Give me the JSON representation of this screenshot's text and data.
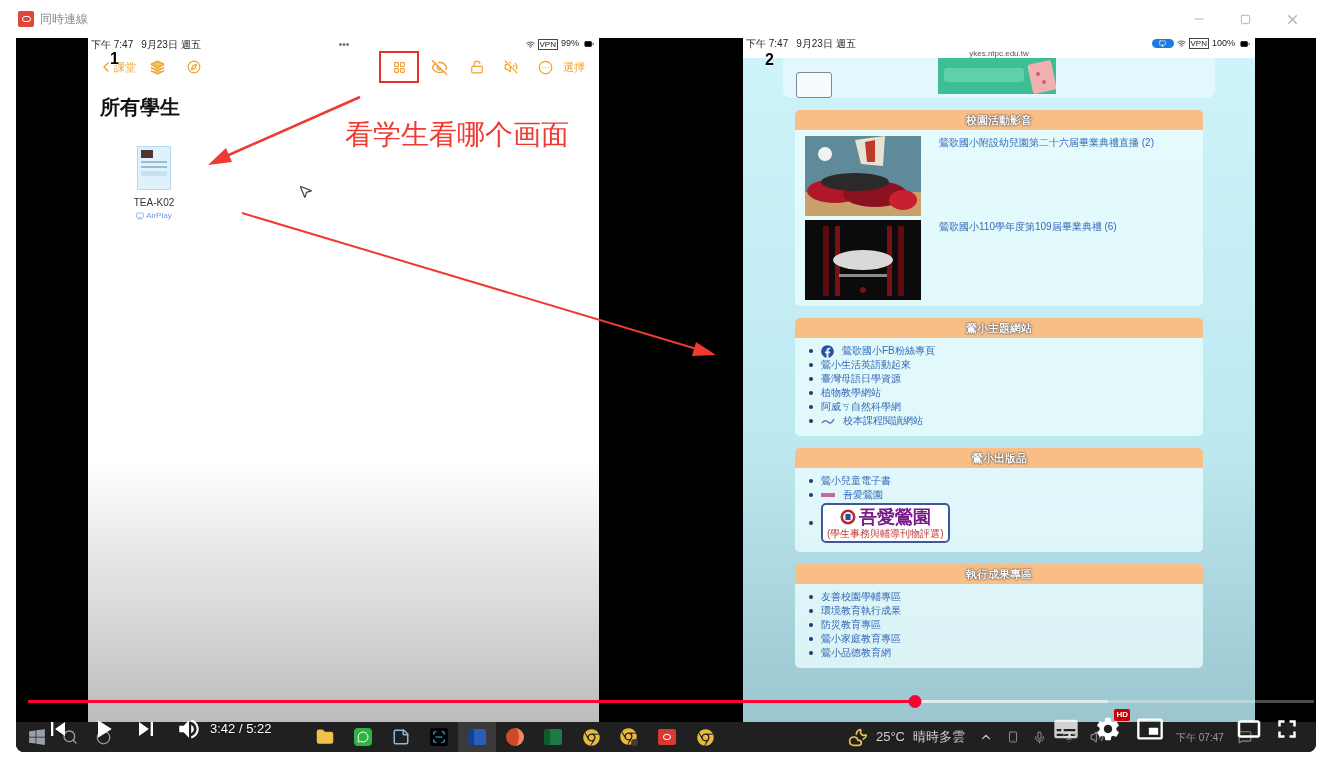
{
  "window": {
    "title": "同時連線"
  },
  "left_screen": {
    "status_bar": {
      "time": "下午 7:47",
      "date": "9月23日 週五",
      "dots": "•••",
      "vpn": "VPN",
      "battery": "99%"
    },
    "toolbar": {
      "back": "課堂",
      "action": "選擇"
    },
    "title": "所有學生",
    "students": [
      {
        "name": "TEA-K02",
        "status": "AirPlay"
      }
    ]
  },
  "right_screen": {
    "status_bar": {
      "time": "下午 7:47",
      "date": "9月23日 週五",
      "vpn": "VPN",
      "battery": "100%"
    },
    "url": "ykes.ntpc.edu.tw",
    "sections": [
      {
        "title": "校園活動影音",
        "items": [
          {
            "kind": "media",
            "text": "鶯歌國小附設幼兒園第二十六屆畢業典禮直播 (2)"
          },
          {
            "kind": "media",
            "text": "鶯歌國小110學年度第109屆畢業典禮 (6)"
          }
        ]
      },
      {
        "title": "鶯小主題網站",
        "items": [
          {
            "kind": "fb-link",
            "text": "鶯歌國小FB粉絲專頁"
          },
          {
            "kind": "link",
            "text": "鶯小生活英語動起來"
          },
          {
            "kind": "link",
            "text": "臺灣母語日學資源"
          },
          {
            "kind": "link",
            "text": "植物教學網站"
          },
          {
            "kind": "link",
            "text": "阿威ㄎ自然科學網"
          },
          {
            "kind": "mark-link",
            "text": "校本課程閱讀網站"
          }
        ]
      },
      {
        "title": "鶯小出版品",
        "items": [
          {
            "kind": "link",
            "text": "鶯小兒童電子書"
          },
          {
            "kind": "tag-link",
            "text": "吾愛鶯園"
          },
          {
            "kind": "banner",
            "text": "吾愛鶯園",
            "subtitle": "(學生事務與輔導刊物評選)"
          }
        ]
      },
      {
        "title": "執行成果專區",
        "items": [
          {
            "kind": "link",
            "text": "友善校園學輔專區"
          },
          {
            "kind": "link",
            "text": "環境教育執行成果"
          },
          {
            "kind": "link",
            "text": "防災教育專區"
          },
          {
            "kind": "link",
            "text": "鶯小家庭教育專區"
          },
          {
            "kind": "link",
            "text": "鶯小品德教育網"
          }
        ]
      }
    ]
  },
  "annotations": {
    "left_label": "1",
    "right_label": "2",
    "note": "看学生看哪个画面"
  },
  "taskbar": {
    "apps": [
      {
        "kind": "explorer",
        "selected": false
      },
      {
        "kind": "line",
        "selected": false
      },
      {
        "kind": "notes",
        "selected": false
      },
      {
        "kind": "capture",
        "selected": false
      },
      {
        "kind": "word",
        "selected": true
      },
      {
        "kind": "powerpoint",
        "selected": false
      },
      {
        "kind": "excel",
        "selected": false
      },
      {
        "kind": "browser",
        "selected": false
      },
      {
        "kind": "browser-profile",
        "selected": false
      },
      {
        "kind": "mirror",
        "selected": false
      },
      {
        "kind": "browser",
        "selected": false
      }
    ],
    "temperature": "25°C",
    "weather": "晴時多雲",
    "clock": "下午 07:47"
  },
  "player": {
    "time": "3:42 / 5:22",
    "progress": {
      "level": 0.69
    },
    "buffered": {
      "level": 0.84
    },
    "quality_badge": "HD"
  }
}
